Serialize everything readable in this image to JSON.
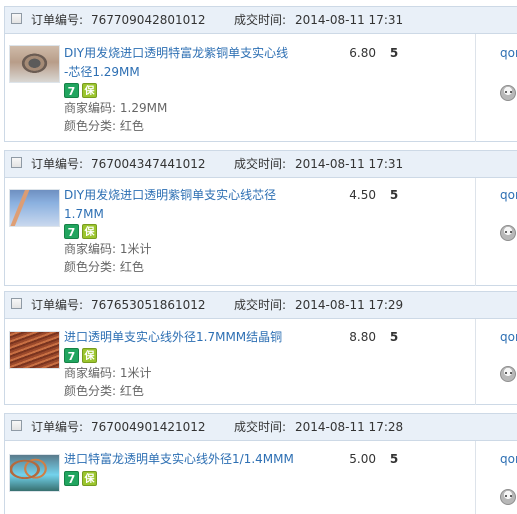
{
  "labels": {
    "order_number": "订单编号:",
    "transaction_time": "成交时间:",
    "merchant_code": "商家编码:",
    "color_category": "颜色分类:"
  },
  "orders": [
    {
      "order_number": "767709042801012",
      "transaction_time": "2014-08-11 17:31",
      "title_line_1": "DIY用发烧进口透明特富龙紫铜单支实心线",
      "title_line_2": "-芯径1.29MM",
      "merchant_code": "1.29MM",
      "color": "红色",
      "price": "6.80",
      "quantity": "5",
      "buyer": "qor",
      "badges": [
        "7",
        "保"
      ]
    },
    {
      "order_number": "767004347441012",
      "transaction_time": "2014-08-11 17:31",
      "title_line_1": "DIY用发烧进口透明紫铜单支实心线芯径",
      "title_line_2": "1.7MM",
      "merchant_code": "1米计",
      "color": "红色",
      "price": "4.50",
      "quantity": "5",
      "buyer": "qor",
      "badges": [
        "7",
        "保"
      ]
    },
    {
      "order_number": "767653051861012",
      "transaction_time": "2014-08-11 17:29",
      "title_line_1": "进口透明单支实心线外径1.7MMM结晶铜",
      "title_line_2": "",
      "merchant_code": "1米计",
      "color": "红色",
      "price": "8.80",
      "quantity": "5",
      "buyer": "qor",
      "badges": [
        "7",
        "保"
      ]
    },
    {
      "order_number": "767004901421012",
      "transaction_time": "2014-08-11 17:28",
      "title_line_1": "进口特富龙透明单支实心线外径1/1.4MMM",
      "title_line_2": "",
      "merchant_code": "",
      "color": "",
      "price": "5.00",
      "quantity": "5",
      "buyer": "qor",
      "badges": [
        "7",
        "保"
      ]
    }
  ],
  "icons": {
    "checkbox": "checkbox-icon",
    "product_thumbnail": "product-thumbnail",
    "seven_day_return": "seven-day-return-icon",
    "guarantee": "guarantee-icon",
    "buyer_avatar": "buyer-avatar-icon"
  },
  "colors": {
    "header_background": "#e9f0f8",
    "border": "#cdd9e6",
    "link": "#2d6fb3",
    "muted_text": "#666666",
    "green_badge": "#21a55f",
    "lime_badge": "#9bc52e"
  }
}
